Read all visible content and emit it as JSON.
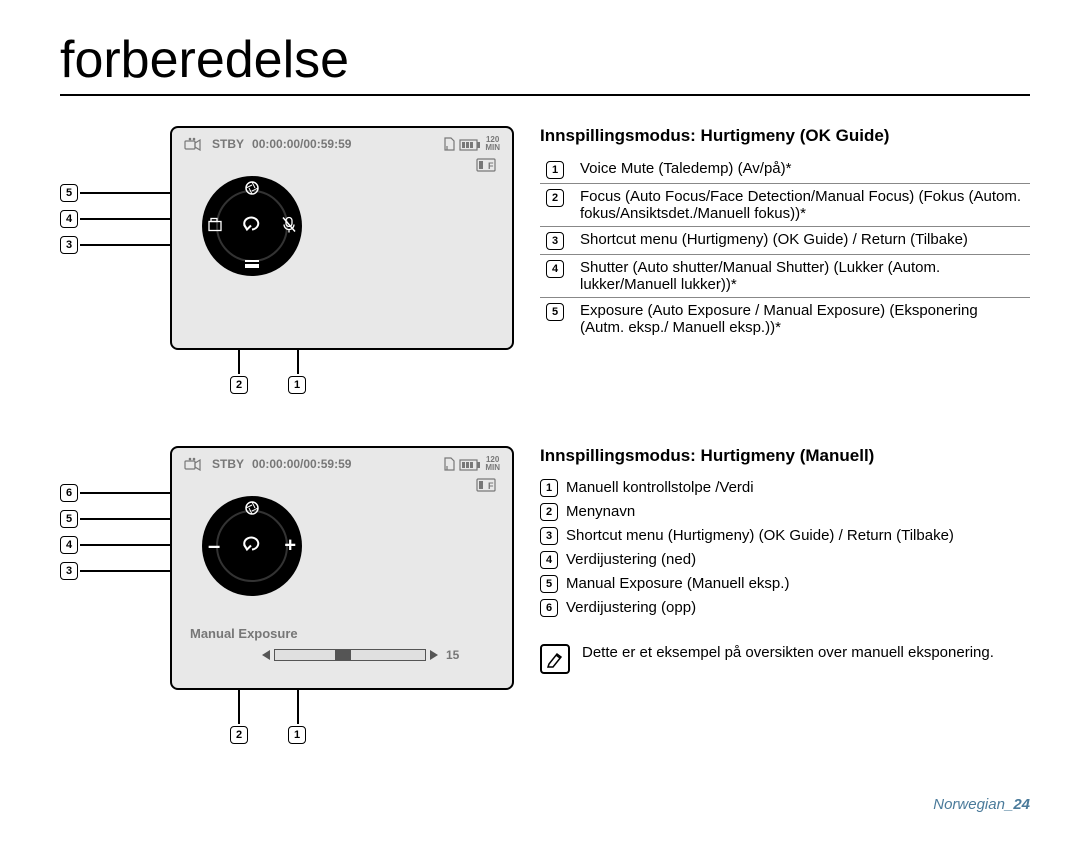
{
  "page": {
    "title": "forberedelse",
    "footer_label": "Norwegian",
    "footer_page": "24"
  },
  "section1": {
    "heading": "Innspillingsmodus: Hurtigmeny (OK Guide)",
    "items": [
      {
        "n": "1",
        "text": "Voice Mute (Taledemp) (Av/på)*"
      },
      {
        "n": "2",
        "text": "Focus (Auto Focus/Face Detection/Manual Focus) (Fokus (Autom. fokus/Ansiktsdet./Manuell fokus))*"
      },
      {
        "n": "3",
        "text": "Shortcut menu (Hurtigmeny) (OK Guide) / Return (Tilbake)"
      },
      {
        "n": "4",
        "text": "Shutter (Auto shutter/Manual Shutter) (Lukker (Autom. lukker/Manuell lukker))*"
      },
      {
        "n": "5",
        "text": "Exposure (Auto Exposure / Manual Exposure) (Eksponering (Autm. eksp./ Manuell eksp.))*"
      }
    ],
    "callouts_left": [
      "5",
      "4",
      "3"
    ],
    "callouts_bottom": [
      "2",
      "1"
    ]
  },
  "section2": {
    "heading": "Innspillingsmodus: Hurtigmeny (Manuell)",
    "items": [
      {
        "n": "1",
        "text": "Manuell kontrollstolpe /Verdi"
      },
      {
        "n": "2",
        "text": "Menynavn"
      },
      {
        "n": "3",
        "text": "Shortcut menu (Hurtigmeny) (OK Guide) / Return (Tilbake)"
      },
      {
        "n": "4",
        "text": "Verdijustering (ned)"
      },
      {
        "n": "5",
        "text": "Manual Exposure (Manuell eksp.)"
      },
      {
        "n": "6",
        "text": "Verdijustering (opp)"
      }
    ],
    "callouts_left": [
      "6",
      "5",
      "4",
      "3"
    ],
    "callouts_bottom": [
      "2",
      "1"
    ],
    "manual_label": "Manual Exposure",
    "slider_value": "15"
  },
  "status": {
    "stby": "STBY",
    "time": "00:00:00/00:59:59",
    "min_top": "120",
    "min_bot": "MIN"
  },
  "note": {
    "text": "Dette er et eksempel på oversikten over manuell eksponering."
  }
}
